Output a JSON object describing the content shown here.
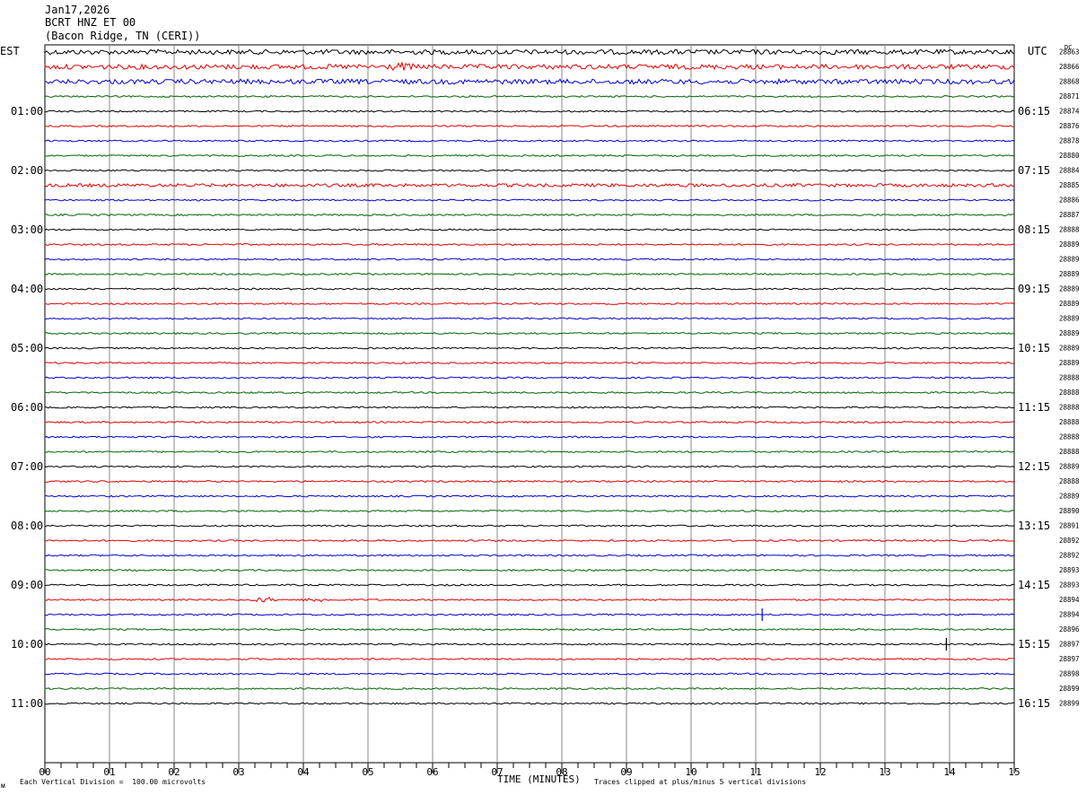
{
  "header": {
    "date": "Jan17,2026",
    "station": "BCRT HNZ ET 00",
    "location": "(Bacon Ridge, TN (CERI))"
  },
  "left_tz": "EST",
  "right_tz": "UTC",
  "dc_label": "DC",
  "footer": {
    "scale": "Each Vertical Division =  100.00 microvolts",
    "clip": "Traces clipped at plus/minus 5 vertical divisions",
    "xlabel": "TIME (MINUTES)"
  },
  "colors": {
    "trace_cycle": [
      "#000000",
      "#e00000",
      "#0000d0",
      "#006400"
    ],
    "grid": "#888888"
  },
  "chart_data": {
    "type": "line",
    "title": "",
    "xlabel": "TIME (MINUTES)",
    "x_ticks": [
      "00",
      "01",
      "02",
      "03",
      "04",
      "05",
      "06",
      "07",
      "08",
      "09",
      "10",
      "11",
      "12",
      "13",
      "14",
      "15"
    ],
    "xlim": [
      0,
      15
    ],
    "left_hour_labels": [
      "01:00",
      "02:00",
      "03:00",
      "04:00",
      "05:00",
      "06:00",
      "07:00",
      "08:00",
      "09:00",
      "10:00",
      "11:00"
    ],
    "right_hour_labels": [
      "06:15",
      "07:15",
      "08:15",
      "09:15",
      "10:15",
      "11:15",
      "12:15",
      "13:15",
      "14:15",
      "15:15",
      "16:15"
    ],
    "dc_values": [
      "28863",
      "28866",
      "28868",
      "28871",
      "28874",
      "28876",
      "28878",
      "28880",
      "28884",
      "28885",
      "28886",
      "28887",
      "28888",
      "28889",
      "28889",
      "28889",
      "28889",
      "28889",
      "28889",
      "28889",
      "28889",
      "28889",
      "28888",
      "28888",
      "28888",
      "28888",
      "28888",
      "28888",
      "28889",
      "28888",
      "28889",
      "28890",
      "28891",
      "28892",
      "28892",
      "28893",
      "28893",
      "28894",
      "28894",
      "28896",
      "28897",
      "28897",
      "28898",
      "28899",
      "28899"
    ],
    "trace_activity": [
      3,
      3,
      3,
      1,
      1,
      1,
      1,
      1,
      1,
      2,
      1,
      1,
      1,
      1,
      1,
      1,
      1,
      1,
      1,
      1,
      1,
      1,
      1,
      1,
      1,
      1,
      1,
      1,
      1,
      1,
      1,
      1,
      1,
      1,
      1,
      1,
      1,
      1,
      1,
      1,
      1,
      1,
      1,
      1,
      1
    ],
    "events": [
      {
        "trace": 38,
        "minute": 11.1,
        "kind": "spike"
      },
      {
        "trace": 40,
        "minute": 13.95,
        "kind": "spike"
      },
      {
        "trace": 37,
        "minute": 3.4,
        "kind": "burst"
      },
      {
        "trace": 37,
        "minute": 4.2,
        "kind": "burst"
      },
      {
        "trace": 1,
        "minute": 5.5,
        "kind": "burst"
      }
    ]
  }
}
